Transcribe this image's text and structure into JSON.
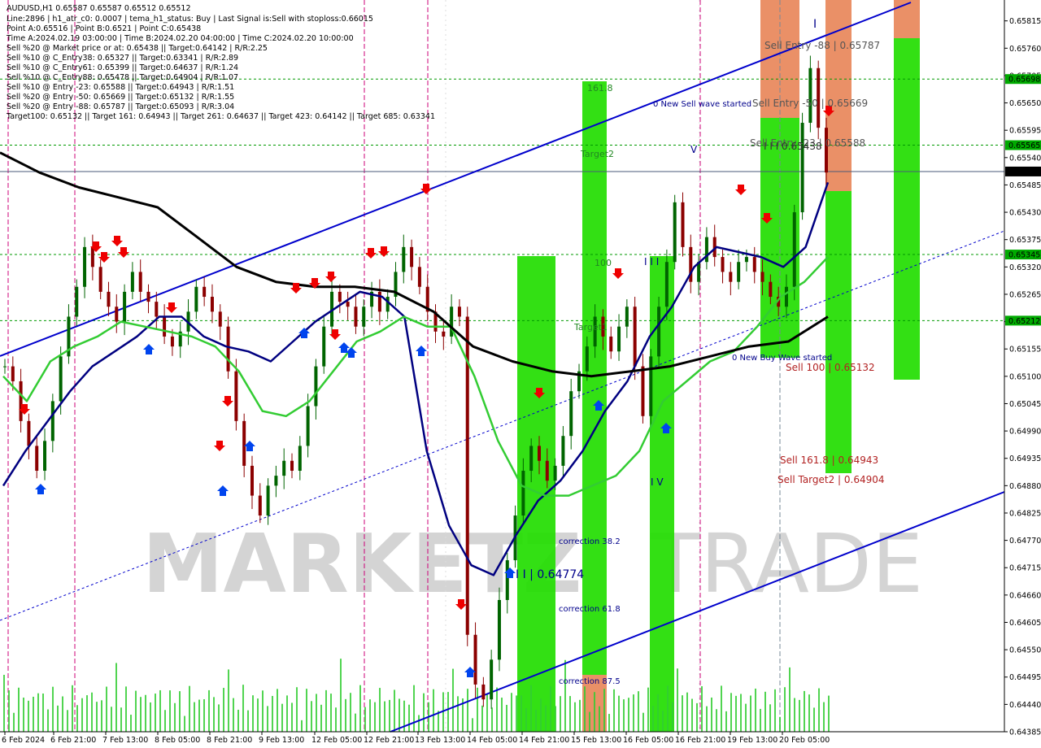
{
  "header": {
    "title": "AUDUSD,H1  0.65587 0.65587 0.65512 0.65512",
    "lines": [
      "Line:2896 | h1_atr_c0: 0.0007 | tema_h1_status: Buy | Last Signal is:Sell with stoploss:0.66015",
      "Point A:0.65516 | Point B:0.6521 | Point C:0.65438",
      "Time A:2024.02.19 03:00:00 | Time B:2024.02.20 04:00:00 | Time C:2024.02.20 10:00:00",
      "Sell %20 @ Market price or at: 0.65438 || Target:0.64142 | R/R:2.25",
      "Sell %10 @ C_Entry38: 0.65327 || Target:0.63341 | R/R:2.89",
      "Sell %10 @ C_Entry61: 0.65399 || Target:0.64637 | R/R:1.24",
      "Sell %10 @ C_Entry88: 0.65478 || Target:0.64904 | R/R:1.07",
      "Sell %10 @ Entry -23: 0.65588 || Target:0.64943 | R/R:1.51",
      "Sell %20 @ Entry -50: 0.65669 || Target:0.65132 | R/R:1.55",
      "Sell %20 @ Entry -88: 0.65787 || Target:0.65093 | R/R:3.04",
      "Target100: 0.65132 || Target 161: 0.64943 || Target 261: 0.64637 || Target 423: 0.64142 || Target 685: 0.63341"
    ]
  },
  "watermark": {
    "left": "MARKETZ",
    "right": "TRADE"
  },
  "colors": {
    "background": "#ffffff",
    "candle_body": "#000000",
    "wick_up": "#006400",
    "wick_down": "#8b0000",
    "tema_blue": "#000080",
    "ma_green": "#33cc33",
    "ma_black": "#000000",
    "channel": "#0000cc",
    "green_zone": "#22dd00",
    "orange_zone": "#e8875a",
    "sell_text": "#b22222",
    "blue_text": "#00008b",
    "dotted_green": "#009900",
    "vline_magenta": "#cc0077",
    "current_price_line": "#4a5a7a"
  },
  "chart_data": {
    "type": "candlestick",
    "symbol": "AUDUSD",
    "timeframe": "H1",
    "ylim": [
      0.64385,
      0.65857
    ],
    "y_ticks": [
      "0.65815",
      "0.65760",
      "0.65705",
      "0.65650",
      "0.65595",
      "0.65540",
      "0.65485",
      "0.65430",
      "0.65375",
      "0.65320",
      "0.65265",
      "0.65210",
      "0.65155",
      "0.65100",
      "0.65045",
      "0.64990",
      "0.64935",
      "0.64880",
      "0.64825",
      "0.64770",
      "0.64715",
      "0.64660",
      "0.64605",
      "0.64550",
      "0.64495",
      "0.64440",
      "0.64385"
    ],
    "x_ticks": [
      "6 Feb 2024",
      "6 Feb 21:00",
      "7 Feb 13:00",
      "8 Feb 05:00",
      "8 Feb 21:00",
      "9 Feb 13:00",
      "12 Feb 05:00",
      "12 Feb 21:00",
      "13 Feb 13:00",
      "14 Feb 05:00",
      "14 Feb 21:00",
      "15 Feb 13:00",
      "16 Feb 05:00",
      "16 Feb 21:00",
      "19 Feb 13:00",
      "20 Feb 05:00"
    ],
    "price_labels": [
      {
        "value": "0.65698",
        "price": 0.65698,
        "color": "#00aa00"
      },
      {
        "value": "0.65565",
        "price": 0.65565,
        "color": "#00aa00"
      },
      {
        "value": "0.65512",
        "price": 0.65512,
        "color": "#000000"
      },
      {
        "value": "0.65345",
        "price": 0.65345,
        "color": "#00aa00"
      },
      {
        "value": "0.65212",
        "price": 0.65212,
        "color": "#00aa00"
      }
    ],
    "close_path": [
      0.6512,
      0.6509,
      0.6501,
      0.6496,
      0.6491,
      0.6497,
      0.6505,
      0.6514,
      0.6522,
      0.6528,
      0.6536,
      0.6532,
      0.6527,
      0.6524,
      0.6521,
      0.6527,
      0.6531,
      0.6527,
      0.6525,
      0.6522,
      0.6518,
      0.6516,
      0.6519,
      0.6523,
      0.6528,
      0.6526,
      0.6523,
      0.652,
      0.6511,
      0.6501,
      0.6492,
      0.6486,
      0.6482,
      0.6488,
      0.649,
      0.6493,
      0.6491,
      0.6496,
      0.6504,
      0.6512,
      0.652,
      0.6527,
      0.6525,
      0.6524,
      0.652,
      0.6524,
      0.6527,
      0.6523,
      0.6526,
      0.6531,
      0.6536,
      0.6532,
      0.6528,
      0.6523,
      0.6519,
      0.6518,
      0.6524,
      0.6522,
      0.6458,
      0.6448,
      0.6445,
      0.6453,
      0.6465,
      0.6473,
      0.6482,
      0.6491,
      0.6496,
      0.6493,
      0.6489,
      0.6492,
      0.6498,
      0.6507,
      0.6511,
      0.6516,
      0.6522,
      0.6518,
      0.6515,
      0.652,
      0.6524,
      0.6512,
      0.6502,
      0.6514,
      0.6524,
      0.6533,
      0.6545,
      0.6536,
      0.6529,
      0.6533,
      0.6538,
      0.6534,
      0.6531,
      0.6529,
      0.6533,
      0.6534,
      0.6531,
      0.6529,
      0.6526,
      0.6524,
      0.6528,
      0.6543,
      0.6561,
      0.6572,
      0.656,
      0.6551
    ],
    "series": [
      {
        "name": "",
        "kind": "tema",
        "values": [
          0.6488,
          0.6495,
          0.6501,
          0.6507,
          0.6512,
          0.6515,
          0.6518,
          0.6522,
          0.6522,
          0.6518,
          0.6516,
          0.6515,
          0.6513,
          0.6517,
          0.6521,
          0.6524,
          0.6527,
          0.6526,
          0.6522,
          0.6495,
          0.648,
          0.6472,
          0.647,
          0.6478,
          0.6485,
          0.6489,
          0.6495,
          0.6503,
          0.6509,
          0.6518,
          0.6524,
          0.6532,
          0.6536,
          0.6535,
          0.6534,
          0.6532,
          0.6536,
          0.6549
        ]
      },
      {
        "name": "",
        "kind": "ma_green",
        "values": [
          0.651,
          0.6505,
          0.6513,
          0.6516,
          0.6518,
          0.6521,
          0.652,
          0.6519,
          0.6518,
          0.6516,
          0.6511,
          0.6503,
          0.6502,
          0.6505,
          0.6511,
          0.6517,
          0.6519,
          0.6522,
          0.652,
          0.652,
          0.651,
          0.6497,
          0.6488,
          0.6486,
          0.6486,
          0.6488,
          0.649,
          0.6495,
          0.6505,
          0.6509,
          0.6513,
          0.6515,
          0.652,
          0.6526,
          0.6529,
          0.6534
        ]
      },
      {
        "name": "",
        "kind": "ma_black",
        "values": [
          0.6555,
          0.6551,
          0.6548,
          0.6546,
          0.6544,
          0.6538,
          0.6532,
          0.6529,
          0.6528,
          0.6528,
          0.6527,
          0.6523,
          0.6516,
          0.6513,
          0.6511,
          0.651,
          0.6511,
          0.6512,
          0.6514,
          0.6516,
          0.6517,
          0.6522
        ]
      }
    ]
  },
  "annotations": {
    "sell_entry_88": "Sell Entry -88 | 0.65787",
    "sell_entry_50": "Sell Entry -50 | 0.65669",
    "sell_entry_23": "Sell Entry -23 | 0.65588",
    "sell_100": "Sell 100 | 0.65132",
    "sell_161": "Sell 161.8 | 0.64943",
    "sell_target2": "Sell Target2 | 0.64904",
    "new_sell_wave": "0 New Sell wave started",
    "new_buy_wave": "0 New Buy Wave started",
    "buy_level": "I I | 0.64774",
    "buy_level_small": "I I I 0.65438",
    "corr_38": "correction 38.2",
    "corr_61": "correction 61.8",
    "corr_87": "correction 87.5",
    "lbl_161": "161.8",
    "lbl_target2": "Target2",
    "lbl_100": "100",
    "lbl_target1": "Target1",
    "wave_v": "V",
    "wave_iv": "I V",
    "wave_iii": "I I I",
    "wave_i": "I"
  }
}
